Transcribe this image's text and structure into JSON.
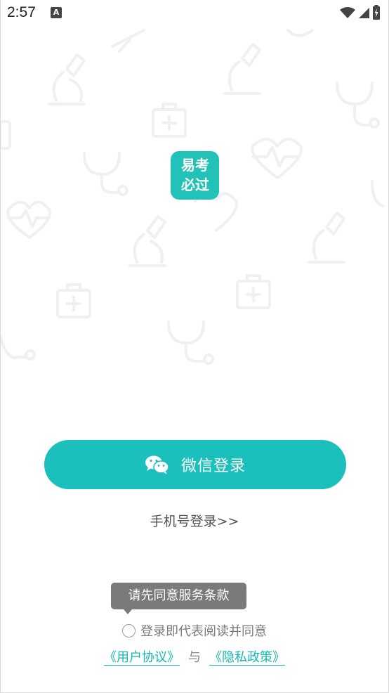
{
  "status_bar": {
    "time": "2:57",
    "notification_icon": "A",
    "icons": [
      "wifi-icon",
      "signal-icon",
      "battery-icon"
    ]
  },
  "app": {
    "logo_text_line1": "易考",
    "logo_text_line2": "必过",
    "brand_color": "#1bbfbc"
  },
  "login": {
    "wechat_label": "微信登录",
    "wechat_icon": "wechat-icon",
    "phone_login_label": "手机号登录>>"
  },
  "agreement": {
    "tooltip": "请先同意服务条款",
    "agree_text": "登录即代表阅读并同意",
    "user_agreement": "《用户协议》",
    "separator": "与",
    "privacy_policy": "《隐私政策》"
  }
}
